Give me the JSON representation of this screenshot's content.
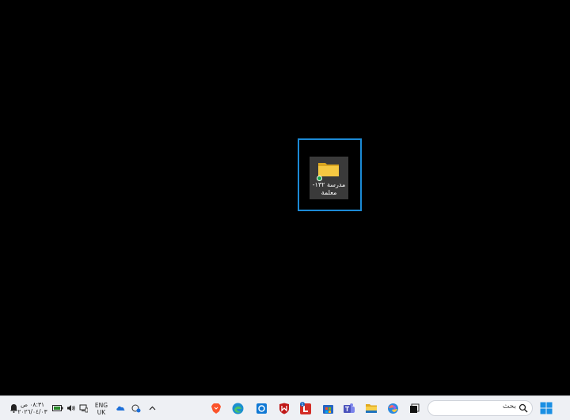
{
  "desktop": {
    "icon": {
      "label_line1": "مدرسة ١٣٢-",
      "label_line2": "معلمة",
      "folder_icon": "folder-icon",
      "status_icon": "synced-check-icon"
    },
    "colors": {
      "background": "#000000",
      "selection": "#1c8ad6",
      "icon_tile": "#3a3a3a",
      "folder": "#f5c842"
    }
  },
  "taskbar": {
    "start_icon": "windows-start-icon",
    "search": {
      "placeholder": "بحث",
      "icon": "search-icon"
    },
    "pinned_apps": [
      "file-explorer-icon",
      "copilot-icon",
      "microsoft-teams-icon",
      "microsoft-store-icon",
      "lastpass-icon",
      "mcafee-icon",
      "outlook-icon",
      "edge-icon",
      "brave-icon"
    ],
    "badge_count": "1",
    "tray": {
      "overflow_icon": "chevron-up-icon",
      "icons": [
        "vpn-icon",
        "onedrive-icon",
        "network-icon",
        "volume-icon",
        "battery-icon"
      ],
      "language_top": "ENG",
      "language_bottom": "UK",
      "time": "٠٨:٣١ ص",
      "date": "٢٠٢٦/٠٤/٠٣",
      "notification_icon": "notification-icon"
    }
  }
}
